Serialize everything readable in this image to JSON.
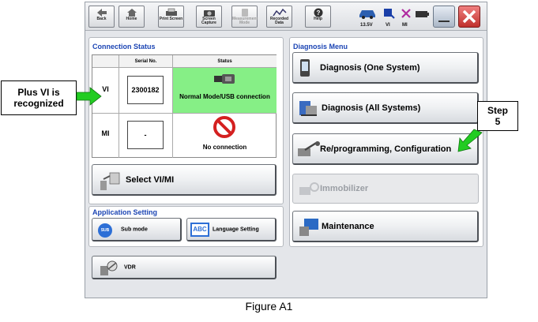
{
  "toolbar": {
    "back_label": "Back",
    "home_label": "Home",
    "print_label": "Print Screen",
    "capture_label": "Screen Capture",
    "measurement_label": "Measurement Mode",
    "recorded_label": "Recorded Data",
    "help_label": "Help",
    "voltage": "13.5V",
    "vi_label": "VI",
    "mi_label": "MI"
  },
  "connection_status": {
    "title": "Connection Status",
    "columns": [
      "Serial No.",
      "Status"
    ],
    "rows": [
      {
        "label": "VI",
        "serial": "2300182",
        "status": "Normal Mode/USB connection",
        "status_color": "#86ef86"
      },
      {
        "label": "MI",
        "serial": "-",
        "status": "No connection"
      }
    ]
  },
  "select_button": "Select VI/MI",
  "application_setting": {
    "title": "Application Setting",
    "sub_mode_label": "Sub mode",
    "sub_icon_text": "SUB",
    "language_label": "Language Setting",
    "language_icon_text": "ABC"
  },
  "vdr_label": "VDR",
  "diagnosis_menu": {
    "title": "Diagnosis Menu",
    "buttons": [
      {
        "label": "Diagnosis (One System)",
        "enabled": true
      },
      {
        "label": "Diagnosis (All Systems)",
        "enabled": true
      },
      {
        "label": "Re/programming, Configuration",
        "enabled": true
      },
      {
        "label": "Immobilizer",
        "enabled": false
      },
      {
        "label": "Maintenance",
        "enabled": true
      }
    ]
  },
  "callouts": {
    "left_line1": "Plus VI is",
    "left_line2": "recognized",
    "right_line1": "Step",
    "right_line2": "5"
  },
  "caption": "Figure A1",
  "colors": {
    "accent_title": "#1c45b4",
    "arrow_green": "#22cc22",
    "no_connection_red": "#d42020"
  }
}
